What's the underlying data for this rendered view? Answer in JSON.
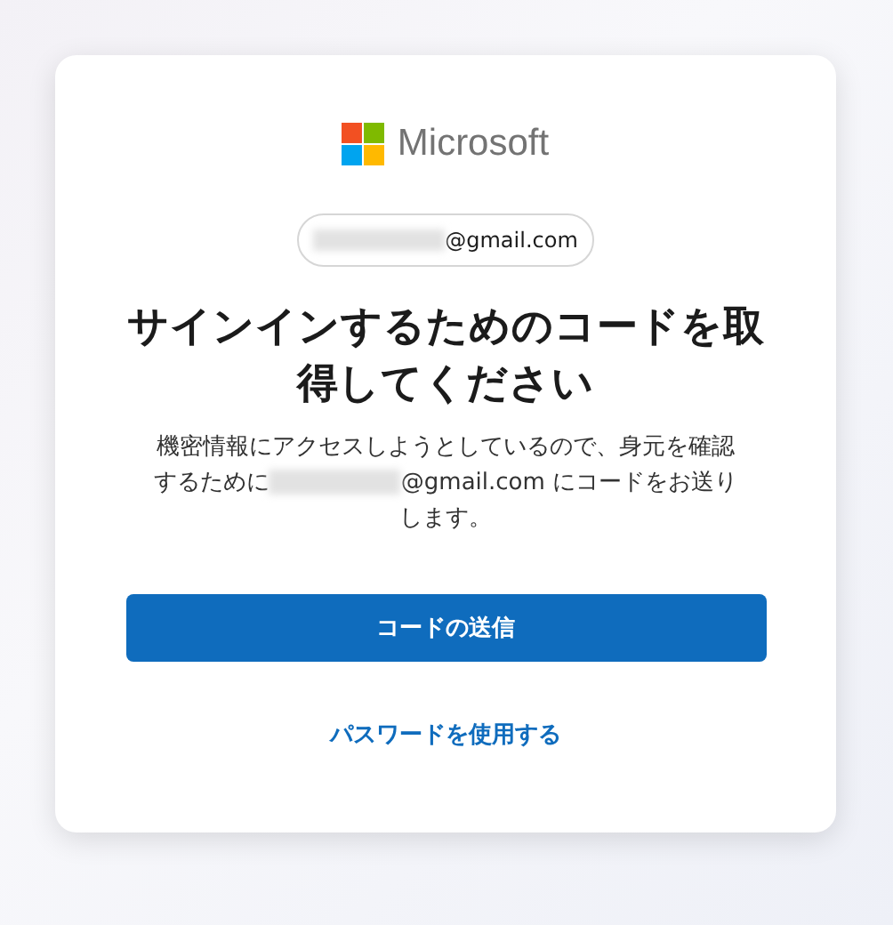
{
  "brand": {
    "name": "Microsoft"
  },
  "account": {
    "email_visible": "@gmail.com",
    "redacted": true
  },
  "title": "サインインするためのコードを取得してください",
  "message": {
    "before": "機密情報にアクセスしようとしているので、身元を確認するために",
    "redacted": true,
    "after": "@gmail.com にコードをお送りします。"
  },
  "buttons": [
    {
      "label": "コードの送信",
      "kind": "primary"
    },
    {
      "label": "パスワードを使用する",
      "kind": "link"
    }
  ]
}
